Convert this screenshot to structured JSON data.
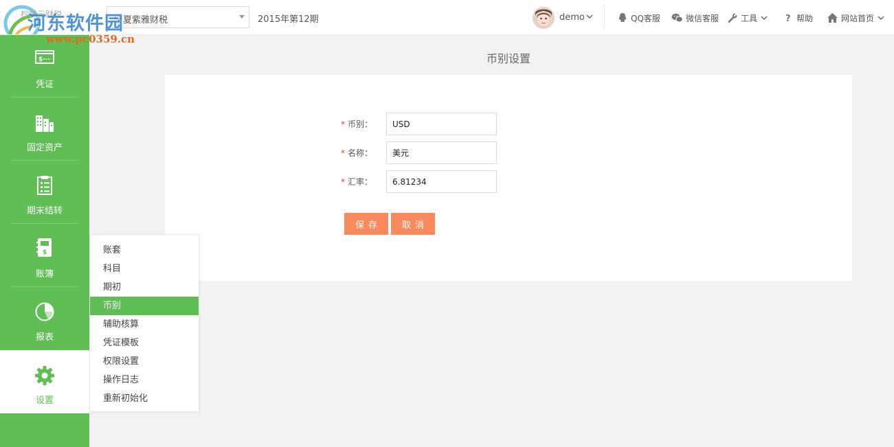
{
  "brand": {
    "text": "柠檬云财税",
    "watermark_title": "河东软件园",
    "watermark_url": "www.pc0359.cn"
  },
  "topbar": {
    "account_select": {
      "value": "宁夏紫雅财税"
    },
    "period": "2015年第12期",
    "user": {
      "name": "demo"
    },
    "links": [
      {
        "label": "QQ客服",
        "icon": "qq-icon"
      },
      {
        "label": "微信客服",
        "icon": "wechat-icon"
      },
      {
        "label": "工具",
        "icon": "wrench-icon",
        "has_dropdown": true
      },
      {
        "label": "帮助",
        "icon": "question-icon"
      },
      {
        "label": "网站首页",
        "icon": "home-icon",
        "has_dropdown": true
      }
    ]
  },
  "sidebar": {
    "items": [
      {
        "label": "凭证",
        "icon": "voucher-icon"
      },
      {
        "label": "固定资产",
        "icon": "building-icon"
      },
      {
        "label": "期末结转",
        "icon": "clipboard-icon"
      },
      {
        "label": "账簿",
        "icon": "ledger-icon"
      },
      {
        "label": "报表",
        "icon": "pie-chart-icon"
      },
      {
        "label": "设置",
        "icon": "gear-icon",
        "active": true
      }
    ]
  },
  "settings_menu": {
    "items": [
      {
        "label": "账套"
      },
      {
        "label": "科目"
      },
      {
        "label": "期初"
      },
      {
        "label": "币别",
        "active": true
      },
      {
        "label": "辅助核算"
      },
      {
        "label": "凭证模板"
      },
      {
        "label": "权限设置"
      },
      {
        "label": "操作日志"
      },
      {
        "label": "重新初始化"
      }
    ]
  },
  "page": {
    "title": "币别设置",
    "form": {
      "required_mark": "*",
      "currency": {
        "label": "币别：",
        "value": "USD"
      },
      "name": {
        "label": "名称：",
        "value": "美元"
      },
      "rate": {
        "label": "汇率：",
        "value": "6.81234"
      }
    },
    "buttons": {
      "save": "保存",
      "cancel": "取消"
    }
  },
  "colors": {
    "sidebar_green": "#5fbe54",
    "button_orange": "#f98a5d",
    "required_red": "#e03a3a"
  }
}
